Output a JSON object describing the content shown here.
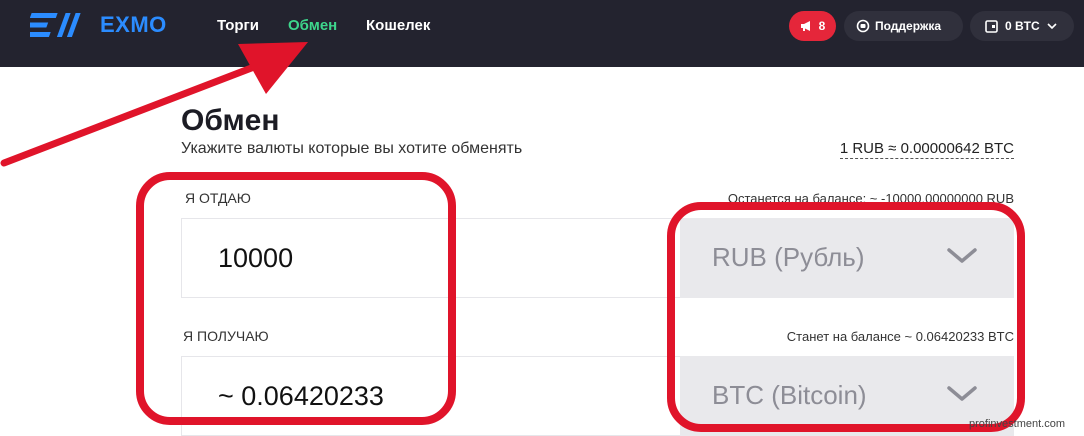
{
  "header": {
    "logo_text": "EXMO",
    "nav": [
      {
        "label": "Торги"
      },
      {
        "label": "Обмен"
      },
      {
        "label": "Кошелек"
      }
    ],
    "notifications_count": "8",
    "support_label": "Поддержка",
    "balance_label": "0 BTC"
  },
  "exchange": {
    "title": "Обмен",
    "subtitle": "Укажите валюты которые вы хотите обменять",
    "rate": "1 RUB ≈ 0.00000642 BTC",
    "give": {
      "label": "Я ОТДАЮ",
      "amount": "10000",
      "currency": "RUB (Рубль)",
      "balance_note": "Останется на балансе: ~ -10000.00000000 RUB"
    },
    "get": {
      "label": "Я ПОЛУЧАЮ",
      "amount": "~ 0.06420233",
      "currency": "BTC (Bitcoin)",
      "balance_note": "Станет на балансе ~ 0.06420233 BTC"
    }
  },
  "watermark": "profinvestment.com",
  "colors": {
    "header_bg": "#23232f",
    "active_nav": "#3dd68c",
    "brand": "#2b8cff",
    "notification": "#e5263a",
    "annotation": "#e0142a"
  }
}
